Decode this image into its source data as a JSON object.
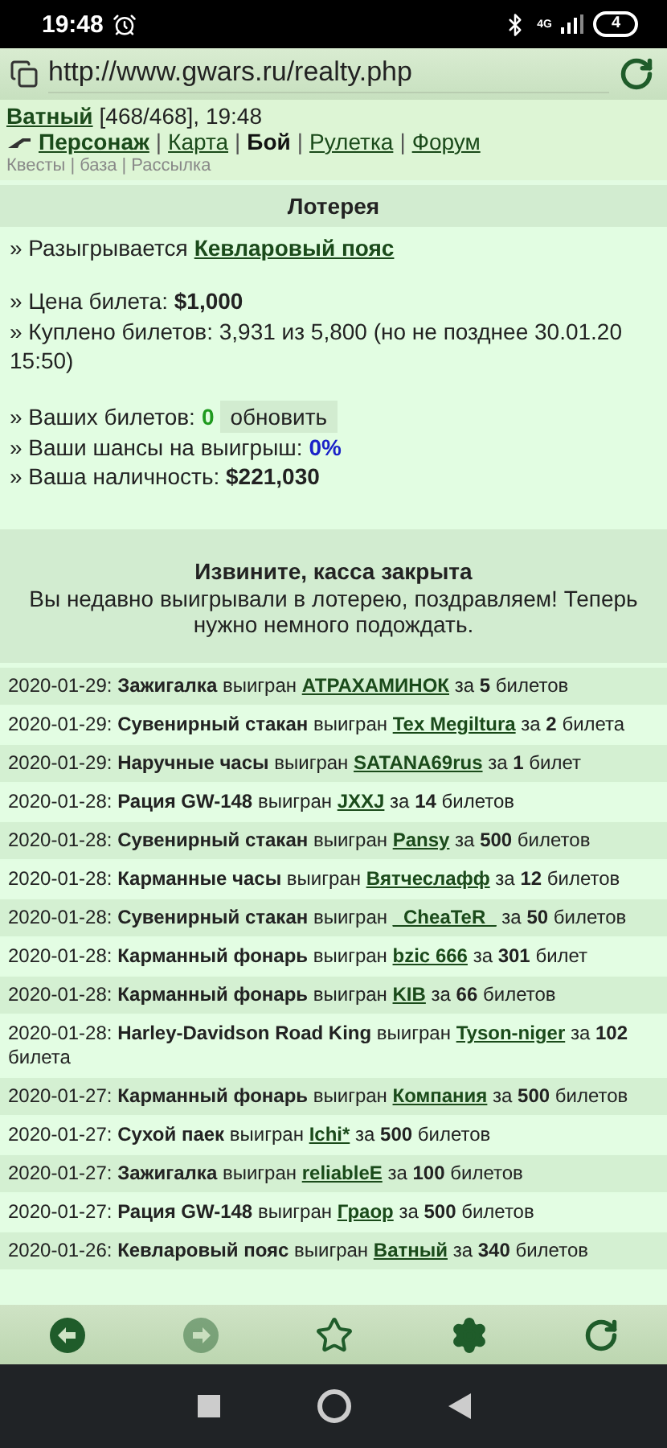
{
  "status_bar": {
    "time": "19:48",
    "network": "4G",
    "battery": "4"
  },
  "address_bar": {
    "url": "http://www.gwars.ru/realty.php"
  },
  "header": {
    "player": "Ватный",
    "stats": "[468/468], 19:48"
  },
  "nav": [
    {
      "label": "Персонаж",
      "current": false,
      "bold": true
    },
    {
      "separator": "|",
      "label": "Карта",
      "current": false,
      "bold": false
    },
    {
      "separator": "|",
      "label": "Бой",
      "current": true,
      "bold": true
    },
    {
      "separator": "|",
      "label": "Рулетка",
      "current": false,
      "bold": false
    },
    {
      "separator": "|",
      "label": "Форум",
      "current": false,
      "bold": false
    }
  ],
  "subnav": [
    {
      "label": "Квесты"
    },
    {
      "separator": "|",
      "label": "база"
    },
    {
      "separator": "|",
      "label": "Рассылка"
    }
  ],
  "lottery": {
    "title": "Лотерея",
    "groups": [
      [
        {
          "kind": "prize",
          "label": "» Разыгрывается",
          "value": "Кевларовый пояс"
        }
      ],
      [
        {
          "kind": "text",
          "label": "» Цена билета: **$1,000**"
        },
        {
          "kind": "text",
          "label": "» Куплено билетов: 3,931 из 5,800 (но не позднее 30.01.20 15:50)"
        }
      ],
      [
        {
          "kind": "tickets",
          "label": "» Ваших билетов:",
          "value": "0",
          "button": "обновить"
        },
        {
          "kind": "chance",
          "label": "» Ваши шансы на выигрыш:",
          "value": "0%"
        },
        {
          "kind": "text",
          "label": "» Ваша наличность: **$221,030**"
        }
      ]
    ]
  },
  "notice": {
    "title": "Извините, касса закрыта",
    "text": "Вы недавно выигрывали в лотерею, поздравляем! Теперь нужно немного подождать."
  },
  "history": [
    {
      "before": "2020-01-29: **Зажигалка** выигран",
      "winner": "АТРАХАМИНОК",
      "after": "за **5** билетов"
    },
    {
      "before": "2020-01-29: **Сувенирный стакан** выигран",
      "winner": "Tex Megiltura",
      "after": "за **2** билета"
    },
    {
      "before": "2020-01-29: **Наручные часы** выигран",
      "winner": "SATANA69rus",
      "after": "за **1** билет"
    },
    {
      "before": "2020-01-28: **Рация GW-148** выигран",
      "winner": "JXXJ",
      "after": "за **14** билетов"
    },
    {
      "before": "2020-01-28: **Сувенирный стакан** выигран",
      "winner": "Pansy",
      "after": "за **500** билетов"
    },
    {
      "before": "2020-01-28: **Карманные часы** выигран",
      "winner": "Вятчеслафф",
      "after": "за **12** билетов"
    },
    {
      "before": "2020-01-28: **Сувенирный стакан** выигран",
      "winner": "_CheaTeR_",
      "after": "за **50** билетов"
    },
    {
      "before": "2020-01-28: **Карманный фонарь** выигран",
      "winner": "bzic 666",
      "after": "за **301** билет"
    },
    {
      "before": "2020-01-28: **Карманный фонарь** выигран",
      "winner": "KIB",
      "after": "за **66** билетов"
    },
    {
      "before": "2020-01-28: **Harley-Davidson Road King** выигран",
      "winner": "Tyson-niger",
      "after": "за **102** билета"
    },
    {
      "before": "2020-01-27: **Карманный фонарь** выигран",
      "winner": "Компания",
      "after": "за **500** билетов"
    },
    {
      "before": "2020-01-27: **Сухой паек** выигран",
      "winner": "Ichi*",
      "after": "за **500** билетов"
    },
    {
      "before": "2020-01-27: **Зажигалка** выигран",
      "winner": "reliableE",
      "after": "за **100** билетов"
    },
    {
      "before": "2020-01-27: **Рация GW-148** выигран",
      "winner": "Граор",
      "after": "за **500** билетов"
    },
    {
      "before": "2020-01-26: **Кевларовый пояс** выигран",
      "winner": "Ватный",
      "after": "за **340** билетов"
    }
  ],
  "toolbar": [
    {
      "kind": "back",
      "disabled": false
    },
    {
      "kind": "forward",
      "disabled": true
    },
    {
      "kind": "bookmark",
      "disabled": false
    },
    {
      "kind": "settings",
      "disabled": false
    },
    {
      "kind": "reload",
      "disabled": false
    }
  ]
}
